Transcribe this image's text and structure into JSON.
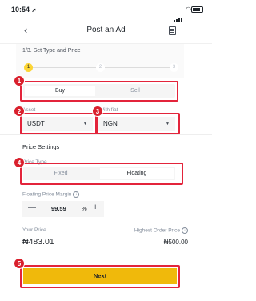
{
  "status_bar": {
    "time": "10:54",
    "location_glyph": "➚"
  },
  "header": {
    "back_glyph": "‹",
    "title": "Post an Ad"
  },
  "step": {
    "title": "1/3. Set Type and Price",
    "steps": [
      {
        "label": "1",
        "active": true
      },
      {
        "label": "2",
        "active": false
      },
      {
        "label": "3",
        "active": false
      }
    ]
  },
  "trade_type": {
    "buy_label": "Buy",
    "sell_label": "Sell",
    "selected": "Buy"
  },
  "asset": {
    "label": "Asset",
    "value": "USDT"
  },
  "fiat": {
    "label": "With fiat",
    "value": "NGN"
  },
  "price_settings": {
    "title": "Price Settings",
    "price_type_label": "Price Type",
    "fixed_label": "Fixed",
    "floating_label": "Floating",
    "selected": "Floating"
  },
  "margin": {
    "label": "Floating Price Margin",
    "value": "99.59",
    "unit": "%"
  },
  "your_price": {
    "label": "Your Price",
    "value": "₦483.01"
  },
  "highest_price": {
    "label": "Highest Order Price",
    "value": "₦500.00"
  },
  "next_label": "Next",
  "annotations": [
    "1",
    "2",
    "3",
    "4",
    "5"
  ],
  "colors": {
    "accent": "#f0b90b",
    "annotation_red": "#d9202d"
  }
}
